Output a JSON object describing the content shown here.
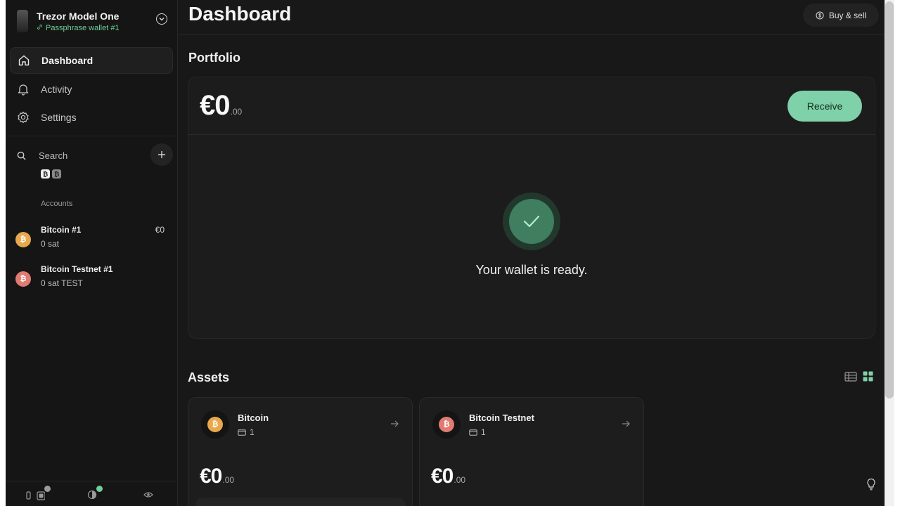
{
  "device": {
    "name": "Trezor Model One",
    "wallet": "Passphrase wallet #1"
  },
  "nav": {
    "items": [
      {
        "label": "Dashboard",
        "icon": "home-icon",
        "active": true
      },
      {
        "label": "Activity",
        "icon": "bell-icon",
        "active": false
      },
      {
        "label": "Settings",
        "icon": "gear-icon",
        "active": false
      }
    ]
  },
  "search": {
    "label": "Search"
  },
  "coin_filters": [
    {
      "symbol": "₿",
      "name": "Bitcoin"
    },
    {
      "symbol": "₿",
      "name": "Bitcoin Testnet"
    }
  ],
  "accounts": {
    "header": "Accounts",
    "items": [
      {
        "name": "Bitcoin #1",
        "balance": "0 sat",
        "fiat": "€0",
        "color": "#e8a84b"
      },
      {
        "name": "Bitcoin Testnet #1",
        "balance": "0 sat TEST",
        "fiat": "",
        "color": "#e07b72"
      }
    ]
  },
  "header": {
    "title": "Dashboard",
    "buy_sell": "Buy & sell"
  },
  "portfolio": {
    "title": "Portfolio",
    "amount_main": "€0",
    "amount_decimals": ".00",
    "receive_label": "Receive",
    "ready_text": "Your wallet is ready."
  },
  "assets": {
    "title": "Assets",
    "items": [
      {
        "name": "Bitcoin",
        "accounts": "1",
        "amount_main": "€0",
        "amount_decimals": ".00",
        "color": "#e8a84b"
      },
      {
        "name": "Bitcoin Testnet",
        "accounts": "1",
        "amount_main": "€0",
        "amount_decimals": ".00",
        "color": "#e07b72"
      }
    ]
  },
  "colors": {
    "accent": "#7fd1a9",
    "background": "#181818",
    "sidebar": "#151515"
  }
}
